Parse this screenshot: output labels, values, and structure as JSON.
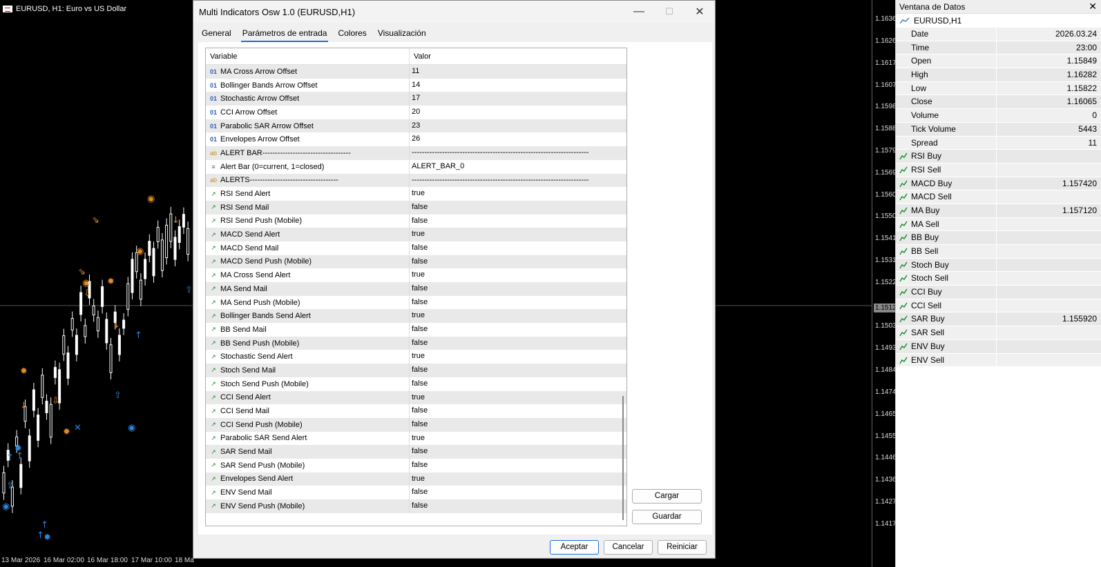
{
  "chart": {
    "title": "EURUSD, H1:  Euro vs US Dollar",
    "prices": [
      "1.16360",
      "1.16265",
      "1.16170",
      "1.16075",
      "1.15980",
      "1.15885",
      "1.15790",
      "1.15695",
      "1.15600",
      "1.15505",
      "1.15410",
      "1.15315",
      "1.15220",
      "1.15030",
      "1.14935",
      "1.14840",
      "1.14745",
      "1.14650",
      "1.14555",
      "1.14460",
      "1.14365",
      "1.14270",
      "1.14175"
    ],
    "current_price": "1.15120",
    "times": [
      "13 Mar 2026",
      "16 Mar 02:00",
      "16 Mar 18:00",
      "17 Mar 10:00",
      "18 Ma"
    ]
  },
  "dialog": {
    "title": "Multi Indicators Osw 1.0 (EURUSD,H1)",
    "tabs": [
      "General",
      "Parámetros de entrada",
      "Colores",
      "Visualización"
    ],
    "col_variable": "Variable",
    "col_value": "Valor",
    "rows": [
      {
        "icon": "01",
        "type": "num",
        "name": "MA Cross Arrow Offset",
        "value": "11"
      },
      {
        "icon": "01",
        "type": "num",
        "name": "Bollinger Bands Arrow Offset",
        "value": "14"
      },
      {
        "icon": "01",
        "type": "num",
        "name": "Stochastic Arrow Offset",
        "value": "17"
      },
      {
        "icon": "01",
        "type": "num",
        "name": "CCI Arrow Offset",
        "value": "20"
      },
      {
        "icon": "01",
        "type": "num",
        "name": "Parabolic SAR Arrow Offset",
        "value": "23"
      },
      {
        "icon": "01",
        "type": "num",
        "name": "Envelopes Arrow Offset",
        "value": "26"
      },
      {
        "icon": "ab",
        "type": "ab",
        "name": "ALERT BAR-----------------------------------",
        "value": "----------------------------------------------------------------------"
      },
      {
        "icon": "≡",
        "type": "enum",
        "name": "Alert Bar (0=current, 1=closed)",
        "value": "ALERT_BAR_0"
      },
      {
        "icon": "ab",
        "type": "ab",
        "name": "ALERTS-----------------------------------",
        "value": "----------------------------------------------------------------------"
      },
      {
        "icon": "↗",
        "type": "bool",
        "name": "RSI Send Alert",
        "value": "true"
      },
      {
        "icon": "↗",
        "type": "bool",
        "name": "RSI Send Mail",
        "value": "false"
      },
      {
        "icon": "↗",
        "type": "bool",
        "name": "RSI Send Push (Mobile)",
        "value": "false"
      },
      {
        "icon": "↗",
        "type": "bool",
        "name": "MACD Send Alert",
        "value": "true"
      },
      {
        "icon": "↗",
        "type": "bool",
        "name": "MACD Send Mail",
        "value": "false"
      },
      {
        "icon": "↗",
        "type": "bool",
        "name": "MACD Send Push (Mobile)",
        "value": "false"
      },
      {
        "icon": "↗",
        "type": "bool",
        "name": "MA Cross Send Alert",
        "value": "true"
      },
      {
        "icon": "↗",
        "type": "bool",
        "name": "MA Send Mail",
        "value": "false"
      },
      {
        "icon": "↗",
        "type": "bool",
        "name": "MA Send Push (Mobile)",
        "value": "false"
      },
      {
        "icon": "↗",
        "type": "bool",
        "name": "Bollinger Bands Send Alert",
        "value": "true"
      },
      {
        "icon": "↗",
        "type": "bool",
        "name": "BB Send Mail",
        "value": "false"
      },
      {
        "icon": "↗",
        "type": "bool",
        "name": "BB Send Push (Mobile)",
        "value": "false"
      },
      {
        "icon": "↗",
        "type": "bool",
        "name": "Stochastic Send Alert",
        "value": "true"
      },
      {
        "icon": "↗",
        "type": "bool",
        "name": "Stoch Send Mail",
        "value": "false"
      },
      {
        "icon": "↗",
        "type": "bool",
        "name": "Stoch Send Push (Mobile)",
        "value": "false"
      },
      {
        "icon": "↗",
        "type": "bool",
        "name": "CCI Send Alert",
        "value": "true"
      },
      {
        "icon": "↗",
        "type": "bool",
        "name": "CCI Send Mail",
        "value": "false"
      },
      {
        "icon": "↗",
        "type": "bool",
        "name": "CCI Send Push (Mobile)",
        "value": "false"
      },
      {
        "icon": "↗",
        "type": "bool",
        "name": "Parabolic SAR Send Alert",
        "value": "true"
      },
      {
        "icon": "↗",
        "type": "bool",
        "name": "SAR Send Mail",
        "value": "false"
      },
      {
        "icon": "↗",
        "type": "bool",
        "name": "SAR Send Push (Mobile)",
        "value": "false"
      },
      {
        "icon": "↗",
        "type": "bool",
        "name": "Envelopes Send Alert",
        "value": "true"
      },
      {
        "icon": "↗",
        "type": "bool",
        "name": "ENV Send Mail",
        "value": "false"
      },
      {
        "icon": "↗",
        "type": "bool",
        "name": "ENV Send Push (Mobile)",
        "value": "false"
      }
    ],
    "btn_load": "Cargar",
    "btn_save": "Guardar",
    "btn_ok": "Aceptar",
    "btn_cancel": "Cancelar",
    "btn_reset": "Reiniciar"
  },
  "data_window": {
    "title": "Ventana de Datos",
    "symbol": "EURUSD,H1",
    "rows": [
      {
        "name": "Date",
        "value": "2026.03.24",
        "ind": false
      },
      {
        "name": "Time",
        "value": "23:00",
        "ind": false
      },
      {
        "name": "Open",
        "value": "1.15849",
        "ind": false
      },
      {
        "name": "High",
        "value": "1.16282",
        "ind": false
      },
      {
        "name": "Low",
        "value": "1.15822",
        "ind": false
      },
      {
        "name": "Close",
        "value": "1.16065",
        "ind": false
      },
      {
        "name": "Volume",
        "value": "0",
        "ind": false
      },
      {
        "name": "Tick Volume",
        "value": "5443",
        "ind": false
      },
      {
        "name": "Spread",
        "value": "11",
        "ind": false
      },
      {
        "name": "RSI Buy",
        "value": "",
        "ind": true
      },
      {
        "name": "RSI Sell",
        "value": "",
        "ind": true
      },
      {
        "name": "MACD Buy",
        "value": "1.157420",
        "ind": true
      },
      {
        "name": "MACD Sell",
        "value": "",
        "ind": true
      },
      {
        "name": "MA Buy",
        "value": "1.157120",
        "ind": true
      },
      {
        "name": "MA Sell",
        "value": "",
        "ind": true
      },
      {
        "name": "BB Buy",
        "value": "",
        "ind": true
      },
      {
        "name": "BB Sell",
        "value": "",
        "ind": true
      },
      {
        "name": "Stoch Buy",
        "value": "",
        "ind": true
      },
      {
        "name": "Stoch Sell",
        "value": "",
        "ind": true
      },
      {
        "name": "CCI Buy",
        "value": "",
        "ind": true
      },
      {
        "name": "CCI Sell",
        "value": "",
        "ind": true
      },
      {
        "name": "SAR Buy",
        "value": "1.155920",
        "ind": true
      },
      {
        "name": "SAR Sell",
        "value": "",
        "ind": true
      },
      {
        "name": "ENV Buy",
        "value": "",
        "ind": true
      },
      {
        "name": "ENV Sell",
        "value": "",
        "ind": true
      }
    ]
  }
}
